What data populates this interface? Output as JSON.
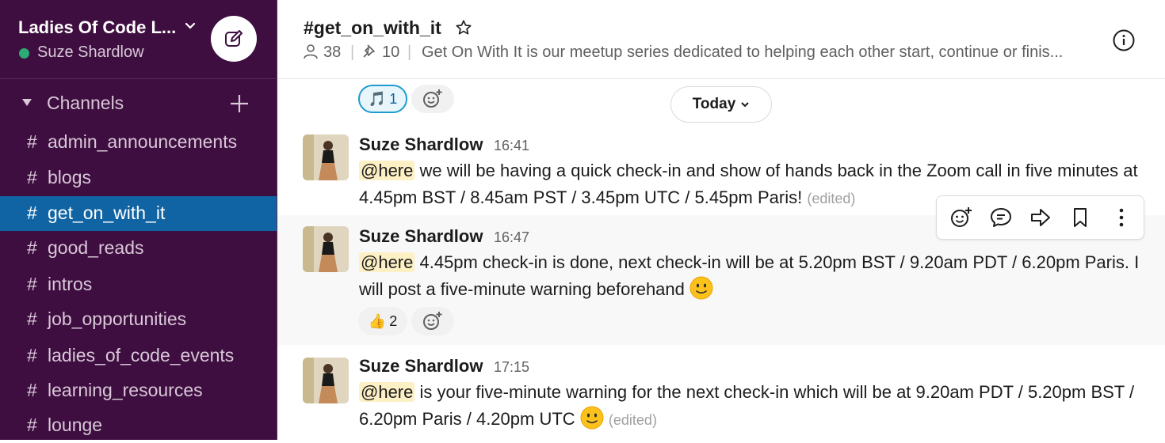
{
  "workspace": {
    "name": "Ladies Of Code L...",
    "user": "Suze Shardlow",
    "status_color": "#2bac76"
  },
  "sidebar": {
    "section_label": "Channels",
    "channels": [
      {
        "label": "admin_announcements"
      },
      {
        "label": "blogs"
      },
      {
        "label": "get_on_with_it",
        "active": true
      },
      {
        "label": "good_reads"
      },
      {
        "label": "intros"
      },
      {
        "label": "job_opportunities"
      },
      {
        "label": "ladies_of_code_events"
      },
      {
        "label": "learning_resources"
      },
      {
        "label": "lounge"
      }
    ],
    "hash": "#"
  },
  "channel": {
    "title": "#get_on_with_it",
    "members": "38",
    "pins": "10",
    "separator": "|",
    "topic": "Get On With It is our meetup series dedicated to helping each other start, continue or finis..."
  },
  "date_divider": "Today",
  "prev_reaction": {
    "emoji": "🎵",
    "count": "1"
  },
  "messages": [
    {
      "sender": "Suze Shardlow",
      "time": "16:41",
      "mention": "@here",
      "text": " we will be having a quick check-in and show of hands back in the Zoom call in five minutes at 4.45pm BST / 8.45am PST / 3.45pm UTC / 5.45pm Paris! ",
      "edited": "(edited)"
    },
    {
      "sender": "Suze Shardlow",
      "time": "16:47",
      "mention": "@here",
      "text": " 4.45pm check-in is done, next check-in will be at 5.20pm BST / 9.20am PDT / 6.20pm Paris.  I will post a five-minute warning beforehand ",
      "reaction": {
        "emoji": "👍",
        "count": "2"
      }
    },
    {
      "sender": "Suze Shardlow",
      "time": "17:15",
      "mention": "@here",
      "text": " is your five-minute warning for the next check-in which will be at 9.20am PDT / 5.20pm BST / 6.20pm Paris / 4.20pm UTC ",
      "edited": "(edited)"
    }
  ],
  "colors": {
    "sidebar": "#3f0e40",
    "active_channel": "#1164a3",
    "mention_bg": "#fdf0c4"
  }
}
